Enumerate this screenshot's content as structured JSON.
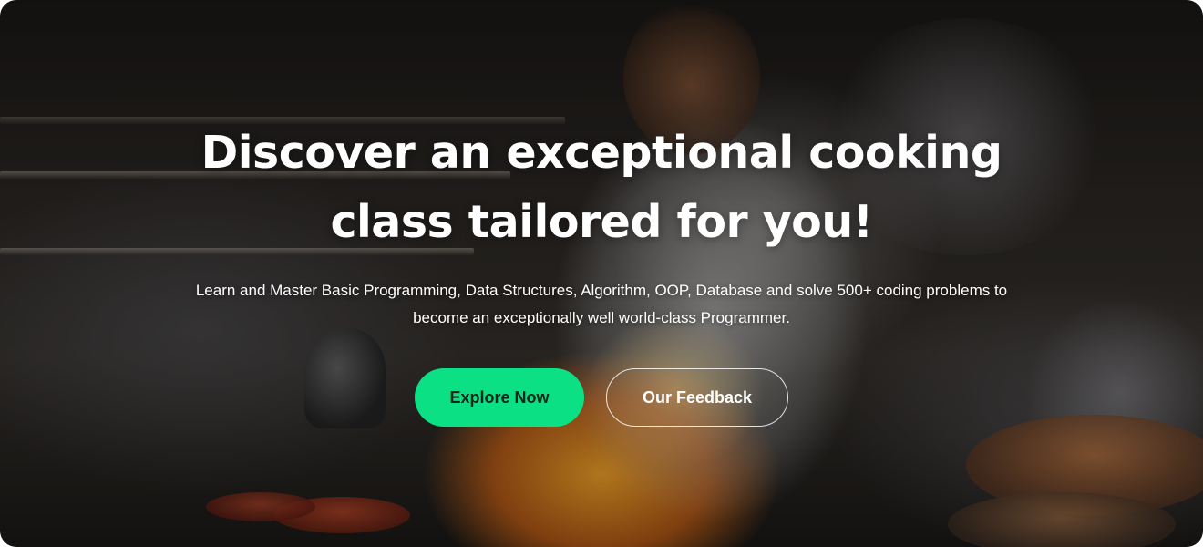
{
  "hero": {
    "headline": "Discover an exceptional cooking class tailored for you!",
    "subtitle": "Learn and Master Basic Programming, Data Structures, Algorithm, OOP, Database and solve 500+ coding problems to become an exceptionally well world-class Programmer.",
    "primary_button_label": "Explore Now",
    "secondary_button_label": "Our Feedback"
  },
  "colors": {
    "accent": "#0CE084",
    "accent_text": "#13241B",
    "text": "#FFFFFF"
  }
}
